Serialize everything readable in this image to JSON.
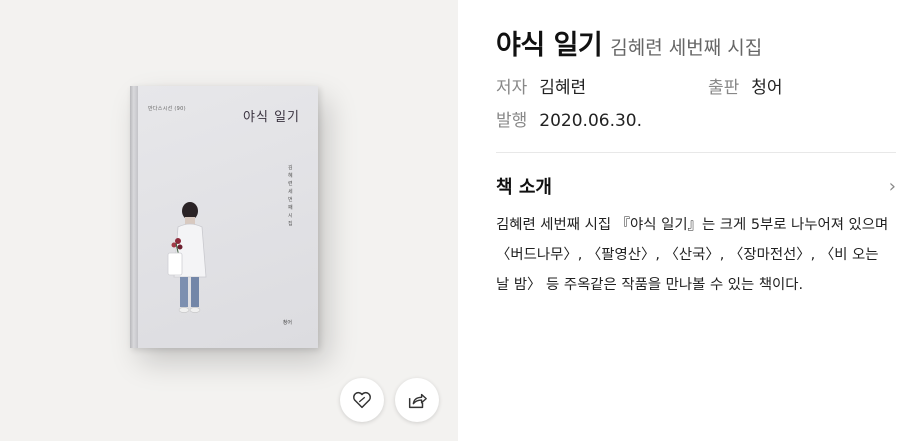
{
  "book": {
    "title": "야식 일기",
    "subtitle": "김혜련 세번째 시집",
    "author_label": "저자",
    "author": "김혜련",
    "publisher_label": "출판",
    "publisher": "청어",
    "date_label": "발행",
    "date": "2020.06.30."
  },
  "cover": {
    "series": "만다스시선 (90)",
    "title": "야식 일기",
    "subtitle": "김혜련 세 번째 시집",
    "publisher": "청어"
  },
  "intro": {
    "title": "책 소개",
    "text": "김혜련 세번째 시집 『야식 일기』는 크게 5부로 나누어져 있으며 〈버드나무〉, 〈팔영산〉, 〈산국〉, 〈장마전선〉, 〈비 오는 날 밤〉 등 주옥같은 작품을 만나볼 수 있는 책이다."
  },
  "actions": {
    "like_icon": "heart-icon",
    "share_icon": "share-icon"
  }
}
